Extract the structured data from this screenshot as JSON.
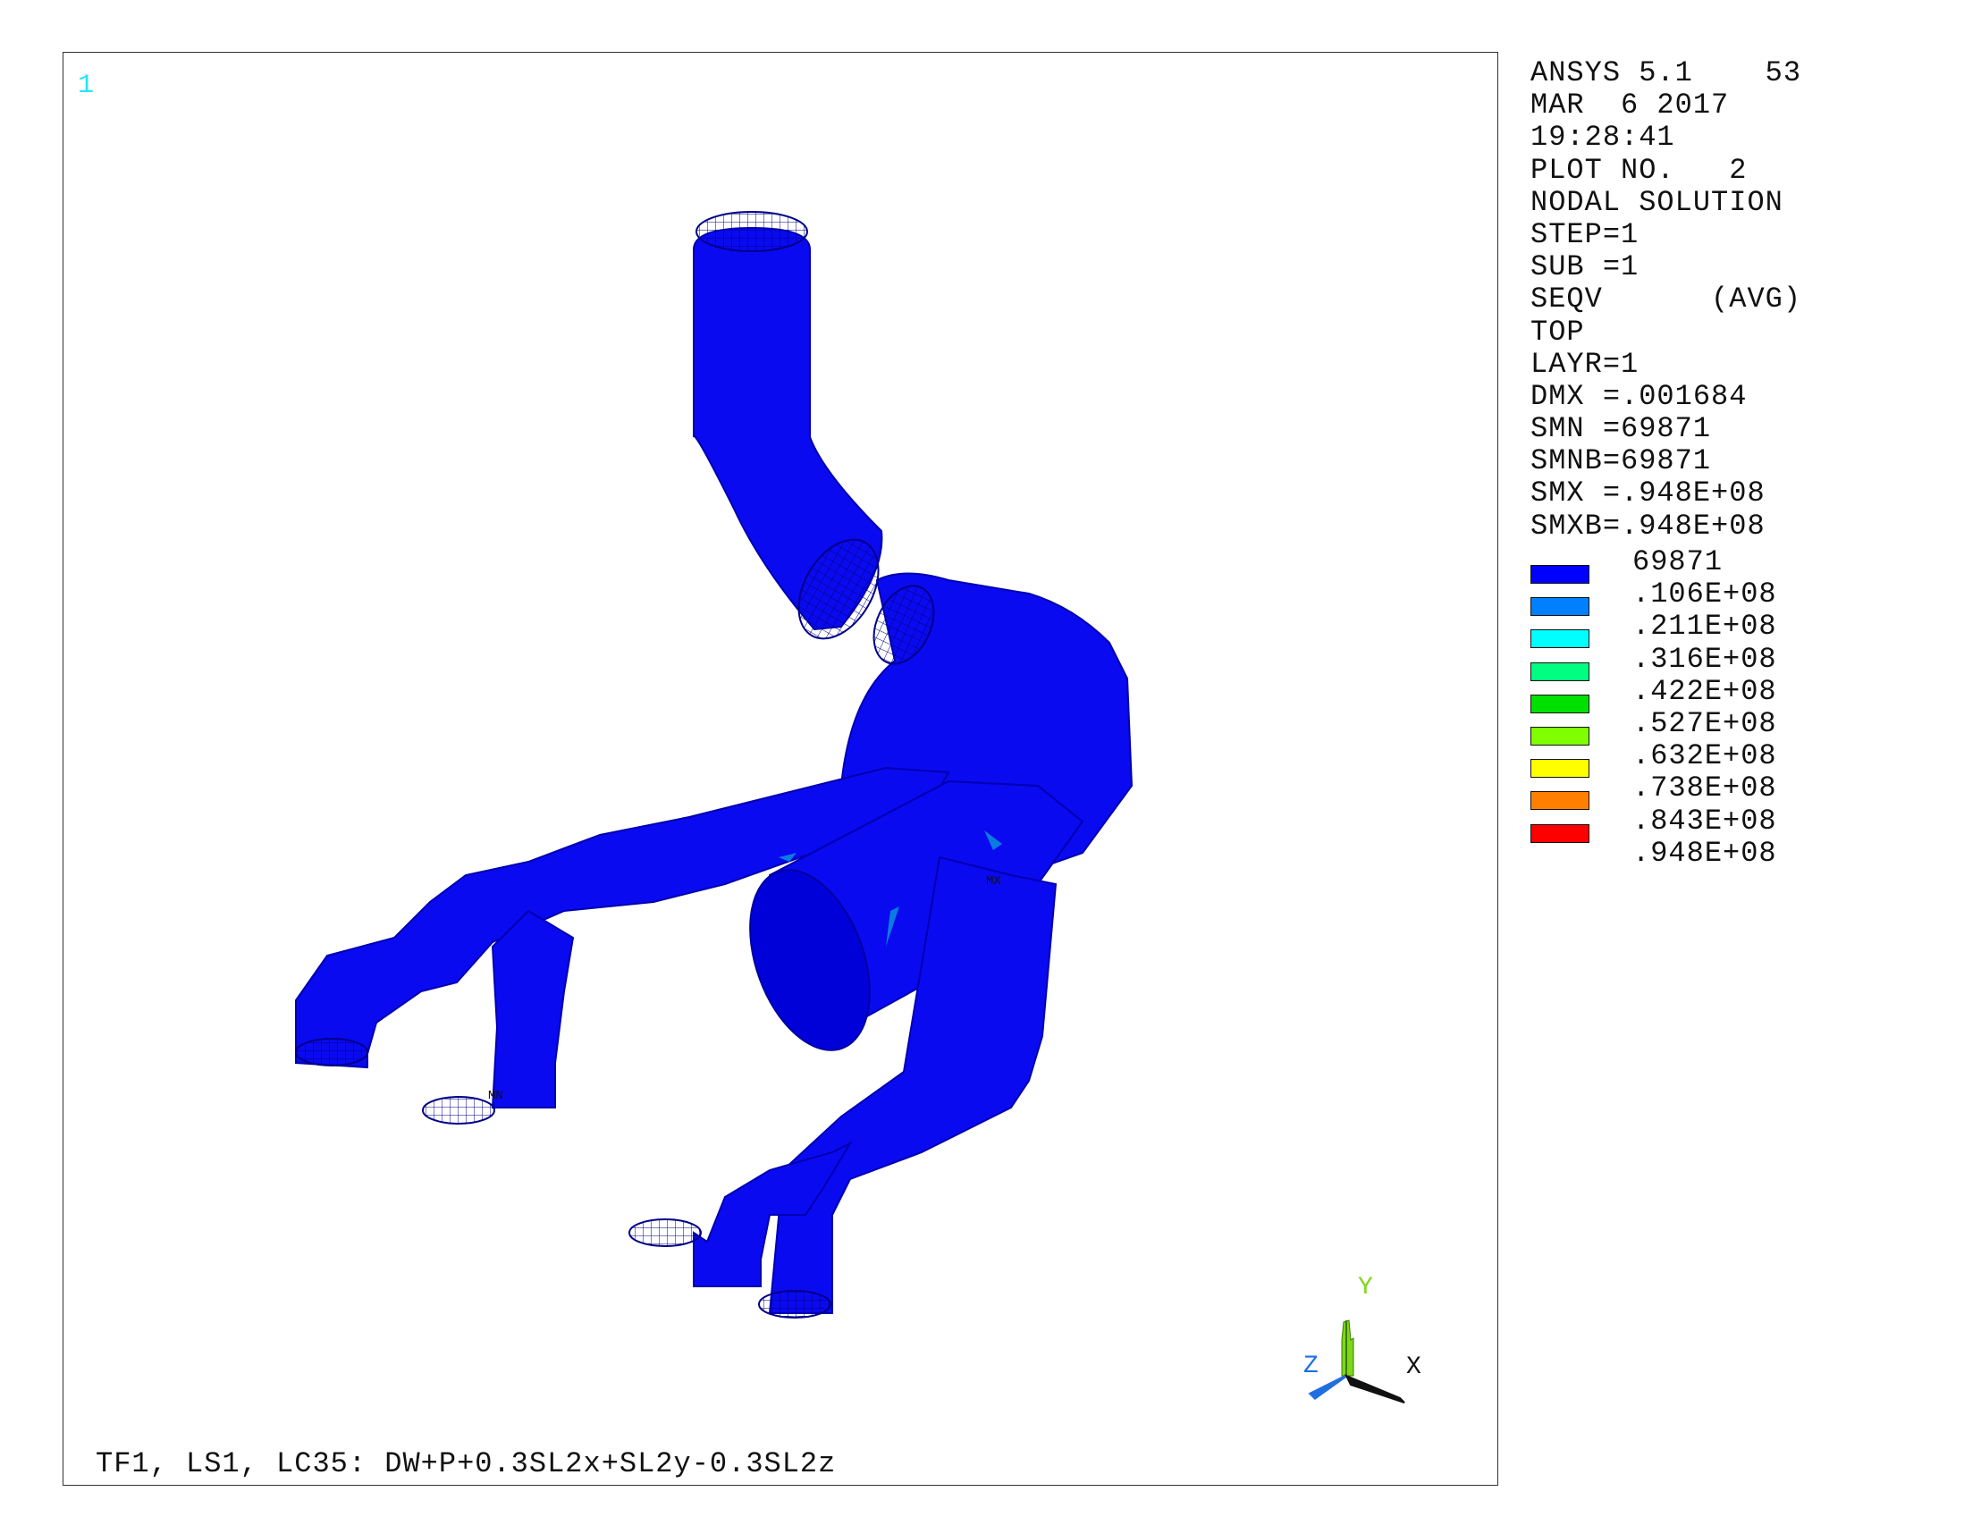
{
  "window": {
    "number": "1"
  },
  "info": [
    "ANSYS 5.1    53",
    "MAR  6 2017",
    "19:28:41",
    "PLOT NO.   2",
    "NODAL SOLUTION",
    "STEP=1",
    "SUB =1",
    "SEQV      (AVG)",
    "TOP",
    "LAYR=1",
    "DMX =.001684",
    "SMN =69871",
    "SMNB=69871",
    "SMX =.948E+08",
    "SMXB=.948E+08"
  ],
  "legend": {
    "levels": [
      {
        "label": "69871",
        "color": "#0000ff"
      },
      {
        "label": ".106E+08",
        "color": "#0080ff"
      },
      {
        "label": ".211E+08",
        "color": "#00ffff"
      },
      {
        "label": ".316E+08",
        "color": "#00ff80"
      },
      {
        "label": ".422E+08",
        "color": "#00e000"
      },
      {
        "label": ".527E+08",
        "color": "#80ff00"
      },
      {
        "label": ".632E+08",
        "color": "#ffff00"
      },
      {
        "label": ".738E+08",
        "color": "#ff8000"
      },
      {
        "label": ".843E+08",
        "color": "#ff0000"
      },
      {
        "label": ".948E+08",
        "color": ""
      }
    ]
  },
  "markers": {
    "min": "MN",
    "max": "MX"
  },
  "triad": {
    "x": "X",
    "y": "Y",
    "z": "Z"
  },
  "caption": "TF1, LS1, LC35: DW+P+0.3SL2x+SL2y-0.3SL2z",
  "colors": {
    "model": "#0a0af0",
    "model_dark": "#0000b8",
    "y_axis": "#7fd61a",
    "z_axis": "#1f6fe0",
    "x_axis": "#111111"
  }
}
